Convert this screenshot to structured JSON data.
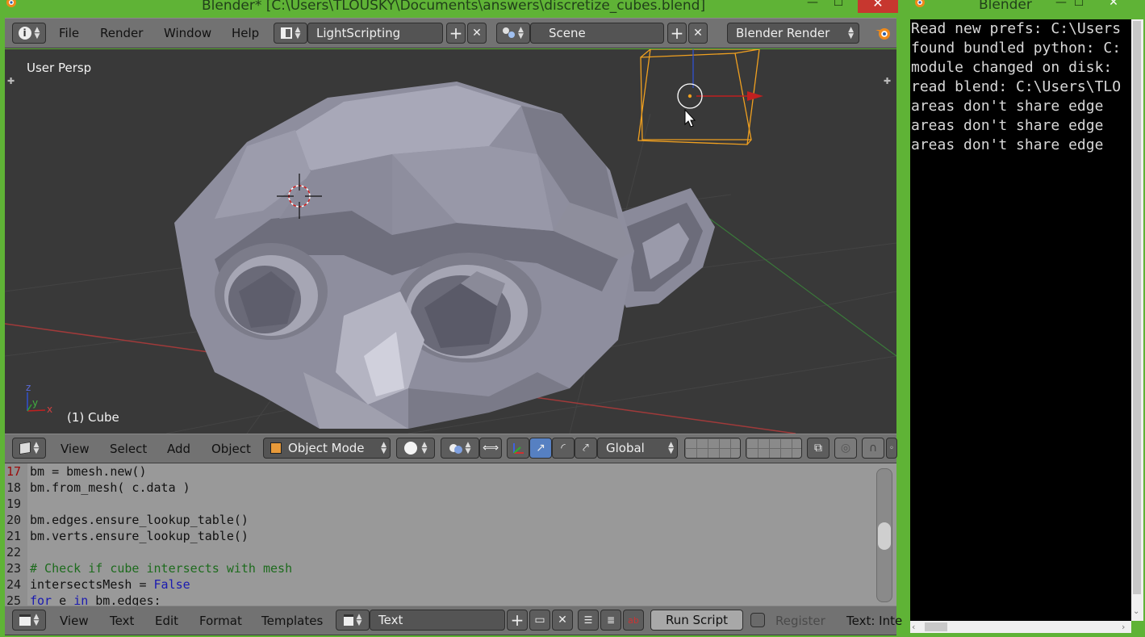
{
  "main_window": {
    "title": "Blender* [C:\\Users\\TLOUSKY\\Documents\\answers\\discretize_cubes.blend]",
    "minimize_glyph": "—",
    "maximize_glyph": "☐",
    "close_glyph": "✕"
  },
  "info_header": {
    "menus": [
      "File",
      "Render",
      "Window",
      "Help"
    ],
    "screen_layout": "LightScripting",
    "scene": "Scene",
    "render_engine": "Blender Render"
  },
  "viewport": {
    "view_label": "User Persp",
    "object_label": "(1) Cube",
    "axis_labels": {
      "z": "z",
      "y": "y",
      "x": "x"
    }
  },
  "view3d_header": {
    "menus": [
      "View",
      "Select",
      "Add",
      "Object"
    ],
    "mode": "Object Mode",
    "orientation": "Global"
  },
  "text_editor": {
    "lines": [
      {
        "num": "17",
        "current": true,
        "segments": [
          {
            "t": "bm = bmesh.new()",
            "c": ""
          }
        ]
      },
      {
        "num": "18",
        "current": false,
        "segments": [
          {
            "t": "bm.from_mesh( c.data )",
            "c": ""
          }
        ]
      },
      {
        "num": "19",
        "current": false,
        "segments": [
          {
            "t": "",
            "c": ""
          }
        ]
      },
      {
        "num": "20",
        "current": false,
        "segments": [
          {
            "t": "bm.edges.ensure_lookup_table()",
            "c": ""
          }
        ]
      },
      {
        "num": "21",
        "current": false,
        "segments": [
          {
            "t": "bm.verts.ensure_lookup_table()",
            "c": ""
          }
        ]
      },
      {
        "num": "22",
        "current": false,
        "segments": [
          {
            "t": "",
            "c": ""
          }
        ]
      },
      {
        "num": "23",
        "current": false,
        "segments": [
          {
            "t": "# Check if cube intersects with mesh",
            "c": "cm"
          }
        ]
      },
      {
        "num": "24",
        "current": false,
        "segments": [
          {
            "t": "intersectsMesh = ",
            "c": ""
          },
          {
            "t": "False",
            "c": "kw"
          }
        ]
      },
      {
        "num": "25",
        "current": false,
        "segments": [
          {
            "t": "for",
            "c": "kw"
          },
          {
            "t": " e ",
            "c": ""
          },
          {
            "t": "in",
            "c": "kw"
          },
          {
            "t": " bm.edges:",
            "c": ""
          }
        ]
      }
    ]
  },
  "text_header": {
    "menus": [
      "View",
      "Text",
      "Edit",
      "Format",
      "Templates"
    ],
    "text_name": "Text",
    "run_script": "Run Script",
    "register": "Register",
    "status": "Text: Inte"
  },
  "console": {
    "title": "Blender",
    "close_glyph": "✕",
    "lines": [
      "Read new prefs: C:\\Users",
      "found bundled python: C:",
      "module changed on disk:",
      "read blend: C:\\Users\\TLO",
      "areas don't share edge",
      "areas don't share edge",
      "areas don't share edge"
    ]
  },
  "colors": {
    "window_frame": "#5fb336",
    "header_bg": "#727272",
    "viewport_bg": "#393939",
    "selection": "#f0a020",
    "accent_blue": "#5680c2",
    "close_red": "#c7372f"
  }
}
